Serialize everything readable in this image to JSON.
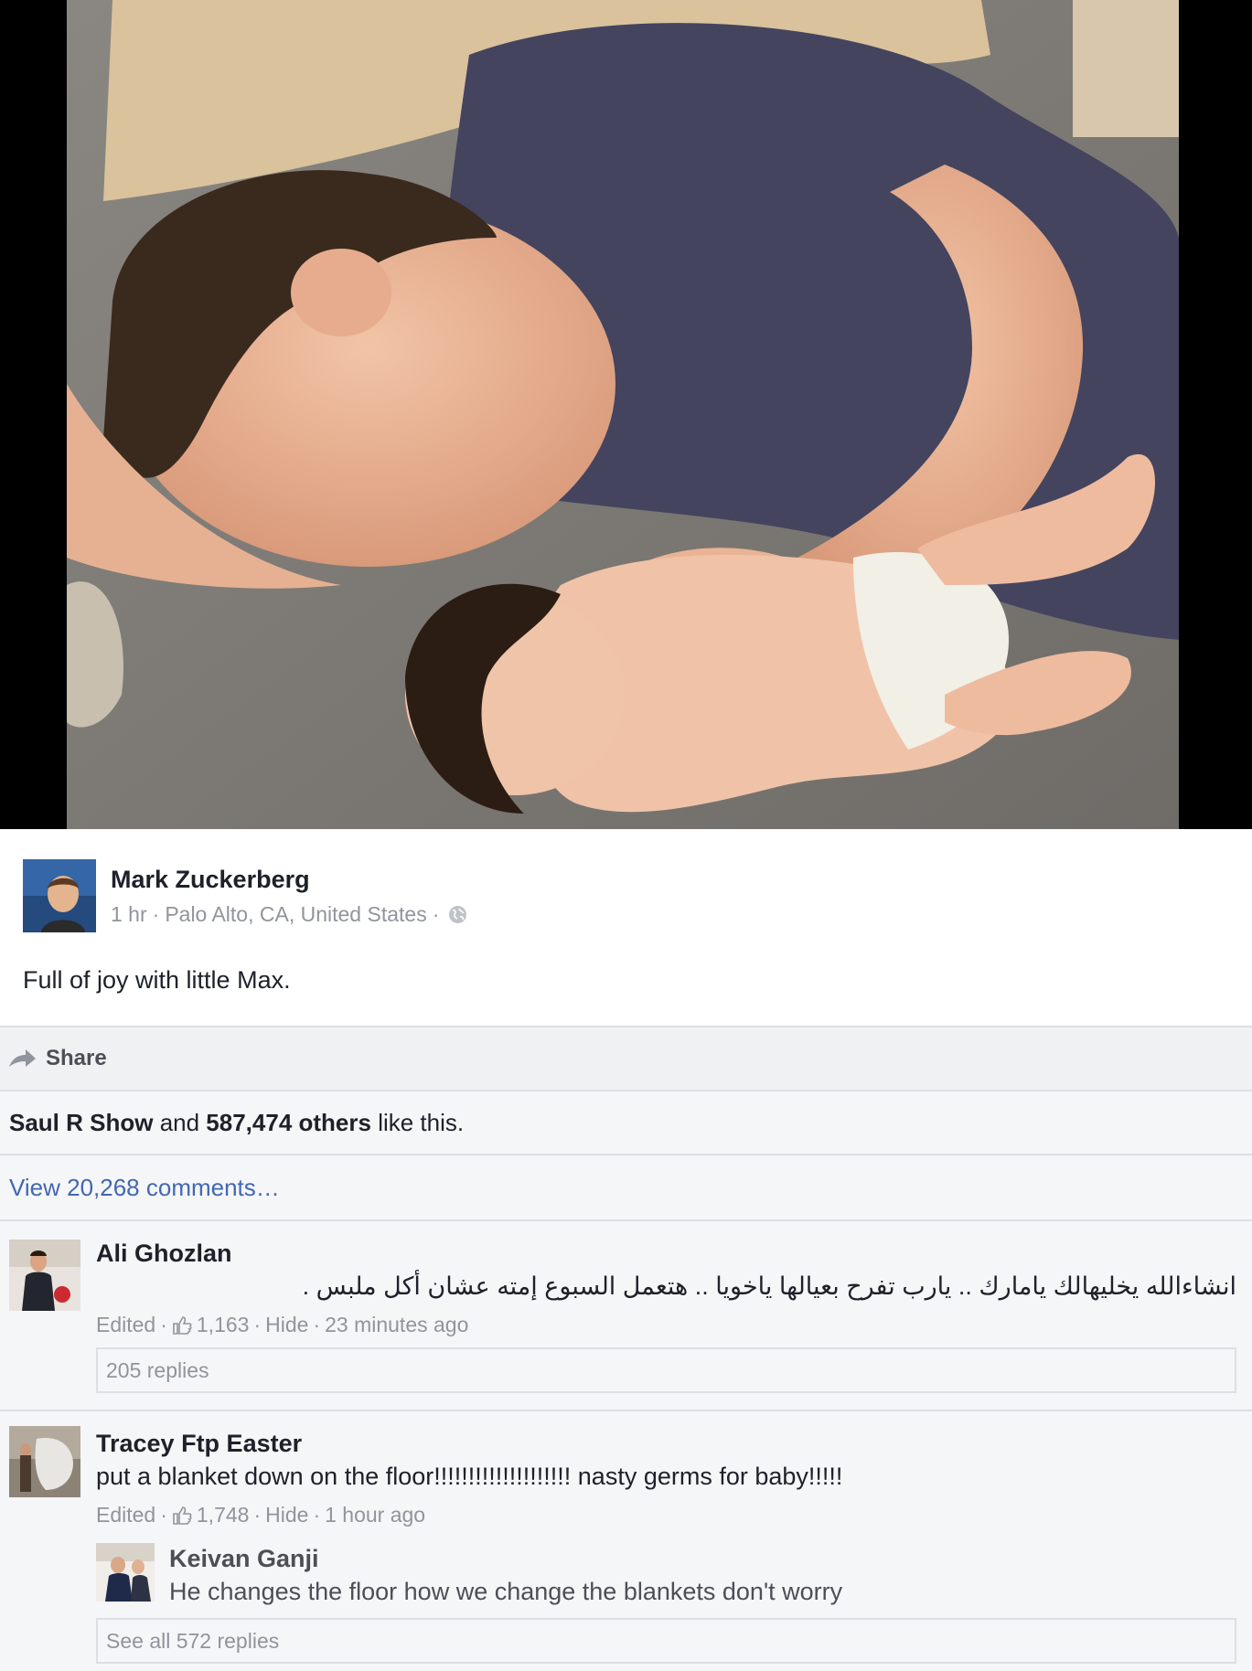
{
  "post": {
    "author": "Mark Zuckerberg",
    "time": "1 hr",
    "location": "Palo Alto, CA, United States",
    "text": "Full of joy with little Max.",
    "privacy_icon": "globe-icon"
  },
  "actions": {
    "share_label": "Share",
    "share_icon": "share-arrow-icon"
  },
  "likes": {
    "first_liker": "Saul R Show",
    "and_text": " and ",
    "others": "587,474 others",
    "suffix": " like this."
  },
  "view_comments": "View 20,268 comments…",
  "comments": [
    {
      "name": "Ali Ghozlan",
      "text": "انشاءالله يخليهالك يامارك .. يارب تفرح بعيالها ياخويا .. هتعمل السبوع إمته عشان أكل ملبس .",
      "edited": "Edited",
      "likes": "1,163",
      "hide": "Hide",
      "time": "23 minutes ago",
      "replies": "205 replies"
    },
    {
      "name": "Tracey Ftp Easter",
      "text": "put a blanket down on the floor!!!!!!!!!!!!!!!!!!!! nasty germs for baby!!!!!",
      "edited": "Edited",
      "likes": "1,748",
      "hide": "Hide",
      "time": "1 hour ago",
      "reply": {
        "name": "Keivan Ganji",
        "text": "He changes the floor how we change the blankets don't worry"
      },
      "replies": "See all 572 replies"
    }
  ],
  "colors": {
    "link_blue": "#4267b2",
    "meta_gray": "#90949c",
    "border": "#dddfe2"
  }
}
